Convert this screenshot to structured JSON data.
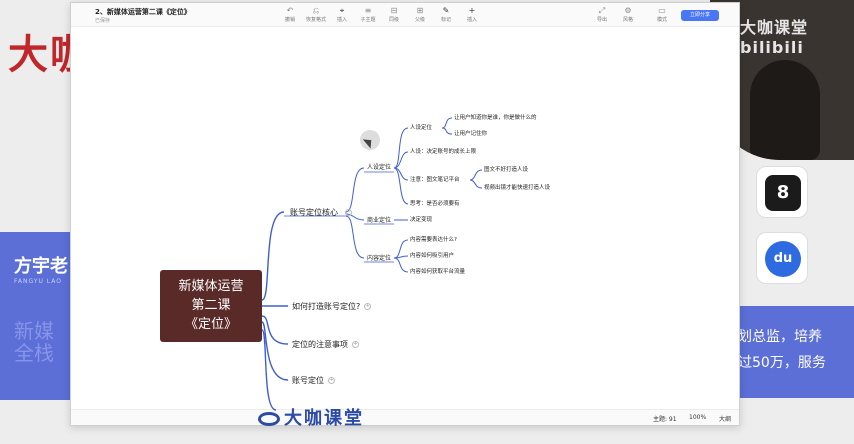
{
  "background": {
    "title": "大咖",
    "left_panel": {
      "name": "方宇老",
      "subtitle": "FANGYU LAO",
      "big_text": "新媒\n全栈"
    },
    "right_panel": {
      "line1": "划总监，培养",
      "line2": "过50万，服务"
    },
    "tile_kuaishou": "8",
    "tile_baidu": "du",
    "webcam_text": "大咖课堂 bilibili"
  },
  "window": {
    "title": "2、新媒体运营第二课《定位》",
    "subtitle": "已保存",
    "toolbar": [
      {
        "icon": "↶",
        "label": "撤销"
      },
      {
        "icon": "⎌",
        "label": "恢复格式"
      },
      {
        "icon": "⌖",
        "label": "插入"
      },
      {
        "icon": "≡",
        "label": "子主题"
      },
      {
        "icon": "⊟",
        "label": "同级"
      },
      {
        "icon": "⊞",
        "label": "父级"
      },
      {
        "icon": "✎",
        "label": "标记"
      },
      {
        "icon": "+",
        "label": "插入"
      },
      {
        "icon": "⤢",
        "label": "导出"
      },
      {
        "icon": "⚙",
        "label": "风格"
      },
      {
        "icon": "▭",
        "label": "模式"
      }
    ],
    "share_label": "立即分享",
    "status": {
      "topics_label": "主题: 91",
      "zoom": "100%",
      "layout": "大纲"
    }
  },
  "mindmap": {
    "root": [
      "新媒体运营",
      "第二课",
      "《定位》"
    ],
    "branches": {
      "b1": "账号定位核心",
      "b2": "如何打造账号定位?",
      "b3": "定位的注意事项",
      "b4": "账号定位"
    },
    "level2": {
      "renshe": "人设定位",
      "shangye": "商业定位",
      "neirong": "内容定位"
    },
    "level3": {
      "renshe_dingwei": "人设定位",
      "renshe_jueding": "人设：决定账号的成长上限",
      "zhuyi": "注意：图文笔记平台",
      "sikao": "思考：是否必须要有",
      "jueding_bianxian": "决定变现",
      "neirong_q1": "内容需要表达什么?",
      "neirong_q2": "内容如何吸引用户",
      "neirong_q3": "内容如何获取平台流量"
    },
    "level4": {
      "rang1": "让用户知道你是谁，你是做什么的",
      "rang2": "让用户记住你",
      "tuwen1": "图文不好打造人设",
      "tuwen2": "视频出镜才能快速打造人设"
    },
    "footer_logo": "大咖课堂"
  }
}
